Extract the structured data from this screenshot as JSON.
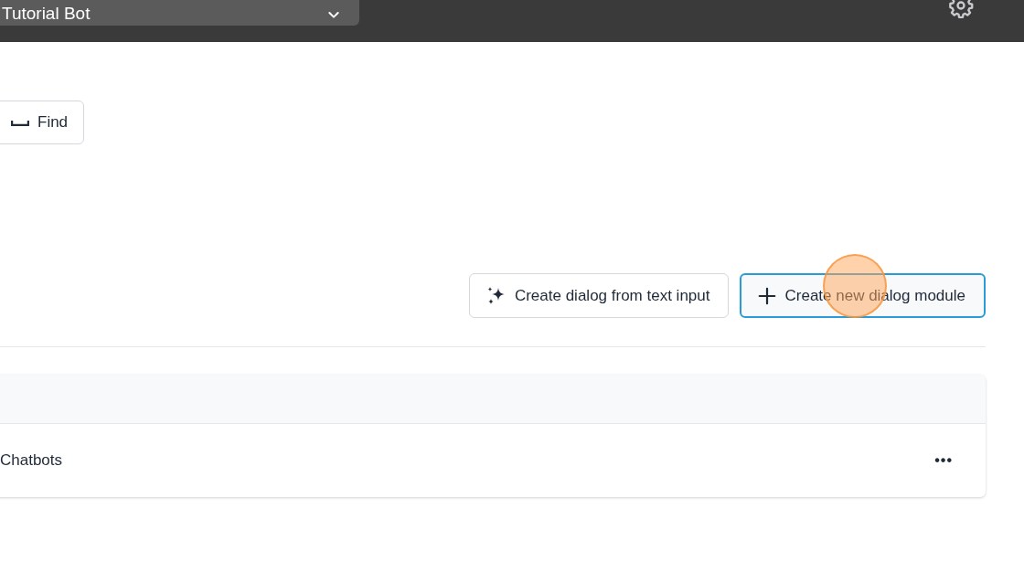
{
  "top_bar": {
    "bot_selector": {
      "value": "Tutorial Bot"
    }
  },
  "find_button": {
    "label": "Find"
  },
  "actions": [
    {
      "kind": "ai",
      "label": "Create dialog from text input",
      "focused": false
    },
    {
      "kind": "add",
      "label": "Create new dialog module",
      "focused": true
    }
  ],
  "table": {
    "rows": [
      {
        "name": "Chatbots",
        "menu": "•••"
      }
    ]
  }
}
